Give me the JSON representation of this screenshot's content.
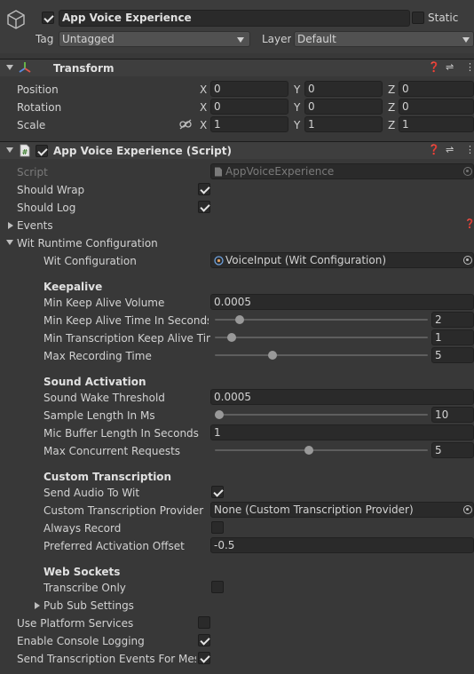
{
  "header": {
    "object_name": "App Voice Experience",
    "static_label": "Static",
    "tag_label": "Tag",
    "tag_value": "Untagged",
    "layer_label": "Layer",
    "layer_value": "Default"
  },
  "transform": {
    "title": "Transform",
    "rows": [
      {
        "label": "Position",
        "x": "0",
        "y": "0",
        "z": "0"
      },
      {
        "label": "Rotation",
        "x": "0",
        "y": "0",
        "z": "0"
      },
      {
        "label": "Scale",
        "x": "1",
        "y": "1",
        "z": "1"
      }
    ],
    "axis": {
      "x": "X",
      "y": "Y",
      "z": "Z"
    }
  },
  "script_component": {
    "title": "App Voice Experience (Script)",
    "script_label": "Script",
    "script_value": "AppVoiceExperience",
    "should_wrap": "Should Wrap",
    "should_log": "Should Log",
    "events": "Events",
    "wit_runtime": "Wit Runtime Configuration",
    "wit_config_label": "Wit Configuration",
    "wit_config_value": "VoiceInput (Wit Configuration)"
  },
  "keepalive": {
    "title": "Keepalive",
    "min_keep_alive_volume_label": "Min Keep Alive Volume",
    "min_keep_alive_volume": "0.0005",
    "min_keep_alive_time_label": "Min Keep Alive Time In Seconds",
    "min_keep_alive_time": "2",
    "min_keep_alive_time_fraction": 0.1,
    "min_transcription_label": "Min Transcription Keep Alive Time",
    "min_transcription": "1",
    "min_transcription_fraction": 0.06,
    "max_recording_label": "Max Recording Time",
    "max_recording": "5",
    "max_recording_fraction": 0.26
  },
  "sound": {
    "title": "Sound Activation",
    "wake_threshold_label": "Sound Wake Threshold",
    "wake_threshold": "0.0005",
    "sample_length_label": "Sample Length In Ms",
    "sample_length": "10",
    "sample_length_fraction": 0.0,
    "mic_buffer_label": "Mic Buffer Length In Seconds",
    "mic_buffer": "1",
    "max_concurrent_label": "Max Concurrent Requests",
    "max_concurrent": "5",
    "max_concurrent_fraction": 0.44
  },
  "custom": {
    "title": "Custom Transcription",
    "send_audio_label": "Send Audio To Wit",
    "provider_label": "Custom Transcription Provider",
    "provider_value": "None (Custom Transcription Provider)",
    "always_record_label": "Always Record",
    "offset_label": "Preferred Activation Offset",
    "offset_value": "-0.5"
  },
  "websockets": {
    "title": "Web Sockets",
    "transcribe_only_label": "Transcribe Only",
    "pubsub_label": "Pub Sub Settings"
  },
  "footer": {
    "platform_services": "Use Platform Services",
    "console_logging": "Enable Console Logging",
    "send_transcription": "Send Transcription Events For Messages"
  }
}
